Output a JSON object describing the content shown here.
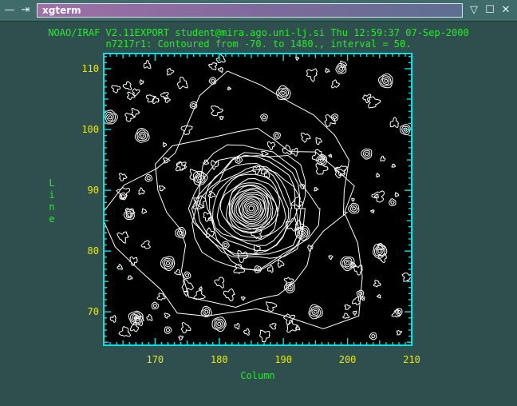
{
  "window": {
    "title": "xgterm",
    "menu_glyph": "—",
    "pin_glyph": "⇥",
    "minimize_glyph": "▽",
    "maximize_glyph": "☐",
    "close_glyph": "✕"
  },
  "plot_header": {
    "line1": "NOAO/IRAF V2.11EXPORT student@mira.ago.uni-lj.si Thu 12:59:37 07-Sep-2000",
    "line2": "n7217r1: Contoured from -70. to 1480., interval = 50."
  },
  "colors": {
    "background": "#2f4f4f",
    "frame": "#00e5e5",
    "tick_labels": "#e8e800",
    "labels": "#22ee22",
    "contours": "#ffffff"
  },
  "chart_data": {
    "type": "contour",
    "xlabel": "Column",
    "ylabel": "Line",
    "xlim": [
      162,
      210
    ],
    "ylim": [
      64.5,
      112.5
    ],
    "x_ticks": [
      170,
      180,
      190,
      200,
      210
    ],
    "y_ticks": [
      70,
      80,
      90,
      100,
      110
    ],
    "contour_min": -70,
    "contour_max": 1480,
    "contour_interval": 50,
    "galaxy_center": [
      185,
      87
    ],
    "field_sources": [
      [
        163,
        102
      ],
      [
        165,
        89
      ],
      [
        166,
        86
      ],
      [
        167,
        69
      ],
      [
        168,
        99
      ],
      [
        169,
        92
      ],
      [
        170,
        71
      ],
      [
        172,
        78
      ],
      [
        172,
        67
      ],
      [
        174,
        83
      ],
      [
        175,
        76
      ],
      [
        176,
        104
      ],
      [
        177,
        92
      ],
      [
        178,
        70
      ],
      [
        179,
        108
      ],
      [
        180,
        68
      ],
      [
        181,
        81
      ],
      [
        183,
        95
      ],
      [
        186,
        77
      ],
      [
        187,
        102
      ],
      [
        189,
        99
      ],
      [
        190,
        106
      ],
      [
        191,
        74
      ],
      [
        193,
        83
      ],
      [
        195,
        70
      ],
      [
        196,
        95
      ],
      [
        198,
        102
      ],
      [
        199,
        110
      ],
      [
        200,
        78
      ],
      [
        201,
        87
      ],
      [
        202,
        73
      ],
      [
        203,
        96
      ],
      [
        205,
        80
      ],
      [
        206,
        108
      ],
      [
        207,
        88
      ],
      [
        208,
        70
      ],
      [
        209,
        100
      ],
      [
        204,
        66
      ]
    ]
  }
}
